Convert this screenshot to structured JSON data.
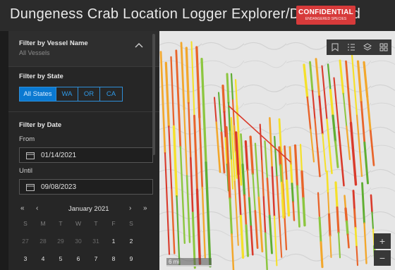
{
  "header": {
    "title": "Dungeness Crab Location Logger Explorer/Dashboard",
    "badge_main": "CONFIDENTIAL",
    "badge_sub": "ENDANGERED SPECIES"
  },
  "vessel_filter": {
    "title": "Filter by Vessel Name",
    "value": "All Vessels"
  },
  "state_filter": {
    "title": "Filter by State",
    "options": [
      "All States",
      "WA",
      "OR",
      "CA"
    ],
    "selected": "All States"
  },
  "date_filter": {
    "title": "Filter by Date",
    "from_label": "From",
    "from_value": "01/14/2021",
    "until_label": "Until",
    "until_value": "09/08/2023"
  },
  "calendar": {
    "month_label": "January 2021",
    "weekdays": [
      "S",
      "M",
      "T",
      "W",
      "T",
      "F",
      "S"
    ],
    "week1": [
      "27",
      "28",
      "29",
      "30",
      "31",
      "1",
      "2"
    ],
    "week2": [
      "3",
      "4",
      "5",
      "6",
      "7",
      "8",
      "9"
    ],
    "nav_prev_year": "«",
    "nav_prev": "‹",
    "nav_next": "›",
    "nav_next_year": "»"
  },
  "map": {
    "scale_label": "6 mi",
    "zoom_in": "+",
    "zoom_out": "−",
    "widgets": [
      "bookmark-icon",
      "legend-icon",
      "layers-icon",
      "basemap-icon"
    ]
  },
  "colors": {
    "accent": "#0a79d1",
    "badge": "#d73a3a",
    "track_colors": [
      "#f5e02a",
      "#f2a72c",
      "#e8642a",
      "#d93a2b",
      "#8cc63f",
      "#5fae32"
    ]
  }
}
